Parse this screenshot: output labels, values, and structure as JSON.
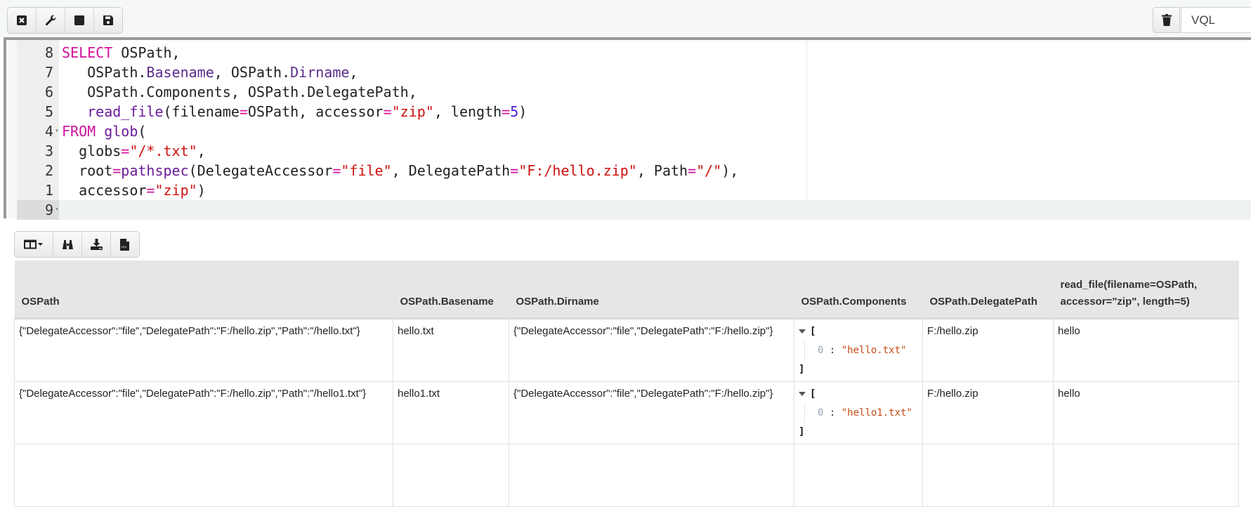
{
  "top_toolbar": {
    "buttons": [
      {
        "name": "close-icon",
        "title": "Close"
      },
      {
        "name": "wrench-icon",
        "title": "Settings"
      },
      {
        "name": "stop-icon",
        "title": "Stop"
      },
      {
        "name": "save-icon",
        "title": "Save"
      }
    ],
    "trash_title": "Delete",
    "search_placeholder": "VQL"
  },
  "editor": {
    "lines": [
      {
        "number": "8",
        "tokens": [
          {
            "t": "kw",
            "v": "SELECT"
          },
          {
            "t": "",
            "v": " OSPath,"
          }
        ]
      },
      {
        "number": "7",
        "tokens": [
          {
            "t": "",
            "v": "   OSPath."
          },
          {
            "t": "prop",
            "v": "Basename"
          },
          {
            "t": "",
            "v": ", OSPath."
          },
          {
            "t": "prop",
            "v": "Dirname"
          },
          {
            "t": "",
            "v": ","
          }
        ]
      },
      {
        "number": "6",
        "tokens": [
          {
            "t": "",
            "v": "   OSPath.Components, OSPath.DelegatePath,"
          }
        ]
      },
      {
        "number": "5",
        "tokens": [
          {
            "t": "",
            "v": "   "
          },
          {
            "t": "fn",
            "v": "read_file"
          },
          {
            "t": "",
            "v": "(filename"
          },
          {
            "t": "op",
            "v": "="
          },
          {
            "t": "",
            "v": "OSPath, accessor"
          },
          {
            "t": "op",
            "v": "="
          },
          {
            "t": "str",
            "v": "\"zip\""
          },
          {
            "t": "",
            "v": ", length"
          },
          {
            "t": "op",
            "v": "="
          },
          {
            "t": "num",
            "v": "5"
          },
          {
            "t": "",
            "v": ")"
          }
        ]
      },
      {
        "number": "4",
        "fold": true,
        "tokens": [
          {
            "t": "kw",
            "v": "FROM"
          },
          {
            "t": "",
            "v": " "
          },
          {
            "t": "fn",
            "v": "glob"
          },
          {
            "t": "",
            "v": "("
          }
        ]
      },
      {
        "number": "3",
        "tokens": [
          {
            "t": "",
            "v": "  globs"
          },
          {
            "t": "op",
            "v": "="
          },
          {
            "t": "str",
            "v": "\"/*.txt\""
          },
          {
            "t": "",
            "v": ","
          }
        ]
      },
      {
        "number": "2",
        "tokens": [
          {
            "t": "",
            "v": "  root"
          },
          {
            "t": "op",
            "v": "="
          },
          {
            "t": "fn",
            "v": "pathspec"
          },
          {
            "t": "",
            "v": "(DelegateAccessor"
          },
          {
            "t": "op",
            "v": "="
          },
          {
            "t": "str",
            "v": "\"file\""
          },
          {
            "t": "",
            "v": ", DelegatePath"
          },
          {
            "t": "op",
            "v": "="
          },
          {
            "t": "str",
            "v": "\"F:/hello.zip\""
          },
          {
            "t": "",
            "v": ", Path"
          },
          {
            "t": "op",
            "v": "="
          },
          {
            "t": "str",
            "v": "\"/\""
          },
          {
            "t": "",
            "v": "),"
          }
        ]
      },
      {
        "number": "1",
        "tokens": [
          {
            "t": "",
            "v": "  accessor"
          },
          {
            "t": "op",
            "v": "="
          },
          {
            "t": "str",
            "v": "\"zip\""
          },
          {
            "t": "",
            "v": ")"
          }
        ]
      },
      {
        "number": "9",
        "fold": true,
        "active": true,
        "tokens": []
      }
    ]
  },
  "results_toolbar": {
    "buttons": [
      {
        "name": "column-selector-icon",
        "title": "Columns"
      },
      {
        "name": "binoculars-icon",
        "title": "Find"
      },
      {
        "name": "download-icon",
        "title": "Download JSON"
      },
      {
        "name": "csv-file-icon",
        "title": "Download CSV"
      }
    ]
  },
  "table": {
    "columns": [
      "OSPath",
      "OSPath.Basename",
      "OSPath.Dirname",
      "OSPath.Components",
      "OSPath.DelegatePath",
      "read_file(filename=OSPath, accessor=\"zip\", length=5)"
    ],
    "rows": [
      {
        "ospath": "{\"DelegateAccessor\":\"file\",\"DelegatePath\":\"F:/hello.zip\",\"Path\":\"/hello.txt\"}",
        "basename": "hello.txt",
        "dirname": "{\"DelegateAccessor\":\"file\",\"DelegatePath\":\"F:/hello.zip\"}",
        "components": {
          "open": "[",
          "close": "]",
          "items": [
            {
              "key": "0",
              "value": "\"hello.txt\""
            }
          ]
        },
        "delegate_path": "F:/hello.zip",
        "read_file": "hello"
      },
      {
        "ospath": "{\"DelegateAccessor\":\"file\",\"DelegatePath\":\"F:/hello.zip\",\"Path\":\"/hello1.txt\"}",
        "basename": "hello1.txt",
        "dirname": "{\"DelegateAccessor\":\"file\",\"DelegatePath\":\"F:/hello.zip\"}",
        "components": {
          "open": "[",
          "close": "]",
          "items": [
            {
              "key": "0",
              "value": "\"hello1.txt\""
            }
          ]
        },
        "delegate_path": "F:/hello.zip",
        "read_file": "hello"
      }
    ]
  }
}
